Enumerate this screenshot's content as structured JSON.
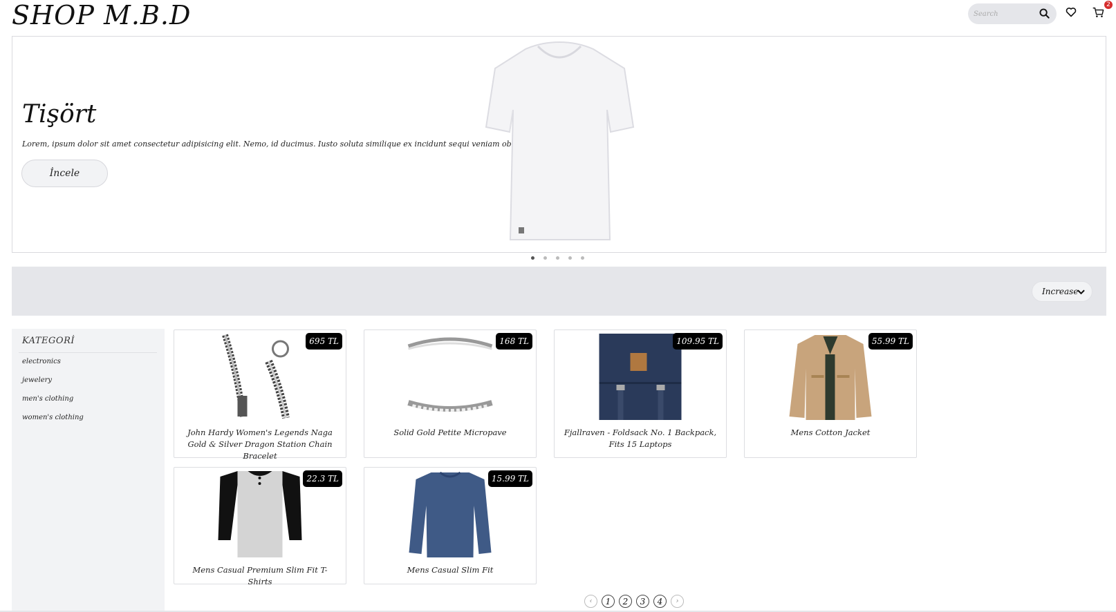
{
  "header": {
    "logo": "SHOP M.B.D",
    "search_placeholder": "Search",
    "cart_count": "2"
  },
  "hero": {
    "title": "Tişört",
    "description": "Lorem, ipsum dolor sit amet consectetur adipisicing elit. Nemo, id ducimus. Iusto soluta similique ex incidunt sequi veniam obcaecati beatae.",
    "button_label": "İncele",
    "slides": 5,
    "active_slide": 1
  },
  "sort": {
    "selected": "Increase"
  },
  "sidebar": {
    "title": "KATEGORİ",
    "items": [
      "electronics",
      "jewelery",
      "men's clothing",
      "women's clothing"
    ]
  },
  "products": [
    {
      "name": "John Hardy Women's Legends Naga Gold & Silver Dragon Station Chain Bracelet",
      "price": "695 TL",
      "image": "bracelet"
    },
    {
      "name": "Solid Gold Petite Micropave",
      "price": "168 TL",
      "image": "ring"
    },
    {
      "name": "Fjallraven - Foldsack No. 1 Backpack, Fits 15 Laptops",
      "price": "109.95 TL",
      "image": "backpack"
    },
    {
      "name": "Mens Cotton Jacket",
      "price": "55.99 TL",
      "image": "jacket"
    },
    {
      "name": "Mens Casual Premium Slim Fit T-Shirts",
      "price": "22.3 TL",
      "image": "raglan-shirt"
    },
    {
      "name": "Mens Casual Slim Fit",
      "price": "15.99 TL",
      "image": "long-sleeve-shirt"
    }
  ],
  "pagination": {
    "prev": "‹",
    "pages": [
      "1",
      "2",
      "3",
      "4"
    ],
    "next": "›"
  },
  "colors": {
    "accent_bar": "#e5e6ea",
    "sidebar_bg": "#f2f3f5",
    "price_tag": "#000000",
    "badge": "#d62d2d"
  }
}
